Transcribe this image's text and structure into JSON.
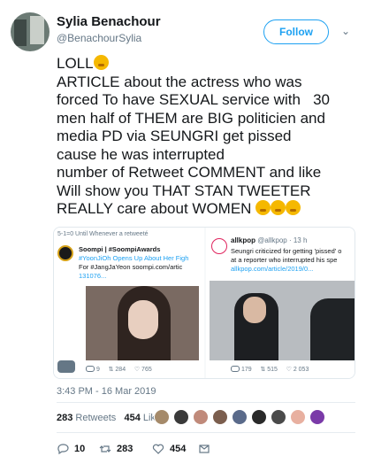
{
  "author": {
    "name": "Sylia Benachour",
    "handle": "@BenachourSylia",
    "follow_label": "Follow"
  },
  "tweet": {
    "lines": [
      "LOLL",
      "ARTICLE about the actress who was",
      "forced To have SEXUAL service with   30",
      "men half of THEM are BIG politicien and",
      "media PD via SEUNGRI get pissed",
      "cause he was interrupted",
      "number of Retweet COMMENT and like",
      "Will show you THAT STAN TWEETER",
      "REALLY care about WOMEN"
    ],
    "timestamp": "3:43 PM - 16 Mar 2019"
  },
  "embedded_left": {
    "top_note": "5-1=0  Until Whenever  a retweeté",
    "name": "Soompi | #SoompiAwards",
    "line1": "#YoonJiOh Opens Up About Her Figh",
    "line2": "For #JangJaYeon soompi.com/artic",
    "line3": "131076...",
    "replies": "9",
    "retweets": "284",
    "likes": "765"
  },
  "embedded_right": {
    "name": "allkpop",
    "handle_time": "@allkpop · 13 h",
    "line1": "Seungri criticized for getting 'pissed' o",
    "line2": "at a reporter who interrupted his spe",
    "line3": "allkpop.com/article/2019/0...",
    "replies": "179",
    "retweets": "515",
    "likes": "2 053"
  },
  "stats": {
    "retweets_count": "283",
    "retweets_label": "Retweets",
    "likes_count": "454",
    "likes_label": "Likes"
  },
  "actions": {
    "replies": "10",
    "retweets": "283",
    "likes": "454"
  },
  "colors": {
    "accent": "#1da1f2",
    "muted": "#657786",
    "text": "#14171a"
  }
}
